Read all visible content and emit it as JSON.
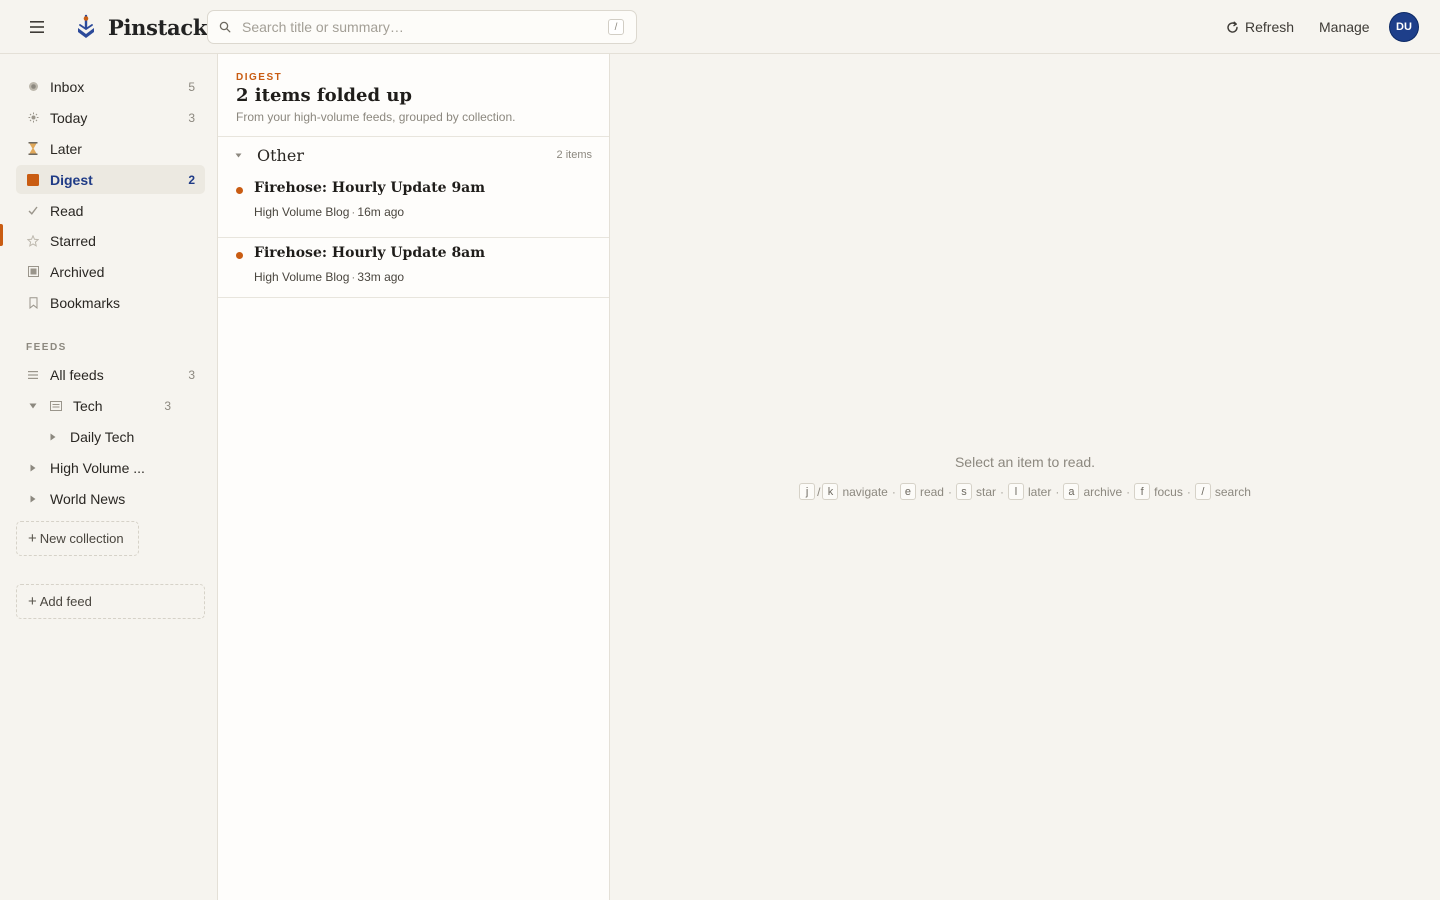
{
  "app": {
    "name": "Pinstack",
    "search_placeholder": "Search title or summary…",
    "search_value": "",
    "search_shortcut": "/",
    "refresh_label": "Refresh",
    "manage_label": "Manage",
    "avatar_initials": "DU",
    "brand_icon": "anchor-logo-icon",
    "accent_color": "#c95c12",
    "selection_color": "#1f3b86",
    "avatar_color": "#1e3f8a"
  },
  "sidebar": {
    "items": [
      {
        "label": "Inbox",
        "count": "5",
        "icon": "inbox-icon"
      },
      {
        "label": "Today",
        "count": "3",
        "icon": "sun-icon"
      },
      {
        "label": "Later",
        "count": "",
        "icon": "hourglass-icon"
      },
      {
        "label": "Digest",
        "count": "2",
        "icon": "digest-icon",
        "active": true
      },
      {
        "label": "Read",
        "count": "",
        "icon": "check-icon"
      },
      {
        "label": "Starred",
        "count": "",
        "icon": "star-icon"
      },
      {
        "label": "Archived",
        "count": "",
        "icon": "archive-icon"
      },
      {
        "label": "Bookmarks",
        "count": "",
        "icon": "bookmark-icon"
      }
    ],
    "feeds_heading": "FEEDS",
    "feeds": [
      {
        "label": "All feeds",
        "count": "3",
        "icon": "list-icon"
      },
      {
        "label": "Tech",
        "count": "3",
        "icon": "folder-icon",
        "expanded": true
      },
      {
        "label": "Daily Tech",
        "count": "",
        "icon": "chevron-right-icon"
      },
      {
        "label": "High Volume ...",
        "count": "",
        "icon": "chevron-right-icon"
      },
      {
        "label": "World News",
        "count": "",
        "icon": "chevron-right-icon"
      }
    ],
    "new_collection_label": "New collection",
    "add_feed_label": "Add feed"
  },
  "list": {
    "eyebrow": "DIGEST",
    "title": "2 items folded up",
    "subtitle": "From your high-volume feeds, grouped by collection.",
    "group": {
      "name": "Other",
      "count_label": "2 items"
    },
    "items": [
      {
        "title": "Firehose: Hourly Update 9am",
        "source": "High Volume Blog",
        "age": "16m ago",
        "unread": true
      },
      {
        "title": "Firehose: Hourly Update 8am",
        "source": "High Volume Blog",
        "age": "33m ago",
        "unread": true
      }
    ]
  },
  "reader": {
    "empty_message": "Select an item to read.",
    "shortcuts": {
      "j": "j",
      "k": "k",
      "navigate": "navigate",
      "e": "e",
      "read": "read",
      "s": "s",
      "star": "star",
      "l": "l",
      "later": "later",
      "a": "a",
      "archive": "archive",
      "f": "f",
      "focus": "focus",
      "slash": "/",
      "search": "search",
      "pair_sep": "/",
      "dot": "·"
    }
  }
}
